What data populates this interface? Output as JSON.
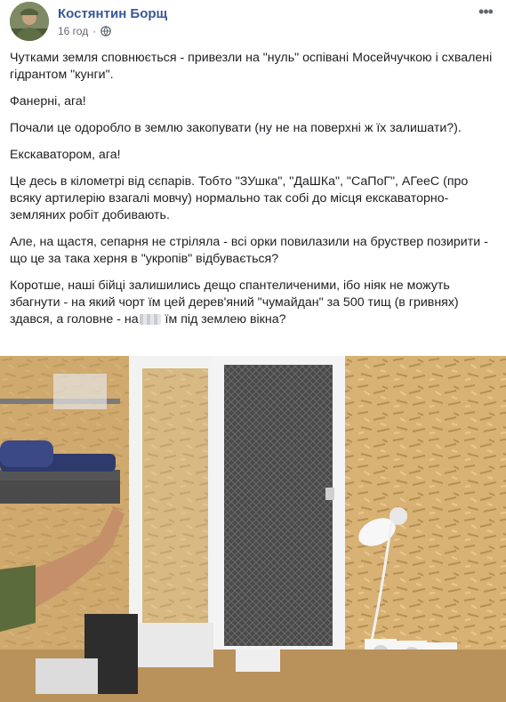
{
  "post": {
    "author": "Костянтин Борщ",
    "time": "16 год",
    "privacy_icon": "globe-icon",
    "menu_icon": "more-dots-icon",
    "paragraphs": [
      "Чутками земля сповнюється - привезли на \"нуль\" оспівані Мосейчучкою і схвалені гідрантом \"кунги\".",
      "Фанерні, ага!",
      "Почали це одоробло в землю закопувати (ну не на поверхні ж їх залишати?).",
      "Екскаватором, ага!",
      "Це десь в кілометрі від сєпарів. Тобто \"ЗУшка\", \"ДаШКа\", \"СаПоГ\", АГееС (про всяку артилерію взагалі мовчу) нормально так собі до місця екскаваторно-земляних робіт добивають.",
      "Але, на щастя, сепарня не стріляла - всі орки повилазили на бруствер позирити - що це за така херня в \"укропів\" відбувається?"
    ],
    "last_paragraph_before": "Коротше, наші бійці залишились дещо спантеличеними, ібо ніяк не можуть збагнути - на який чорт їм цей дерев'яний \"чумайдан\" за 500 тищ (в гривнях) здався, а головне - на",
    "last_paragraph_after": " їм під землею вікна?"
  },
  "colors": {
    "author": "#385898",
    "meta": "#606770",
    "text": "#1c1e21",
    "wall": "#d9b477",
    "window_frame": "#f4f4f4",
    "mesh": "#3d3d3d"
  }
}
